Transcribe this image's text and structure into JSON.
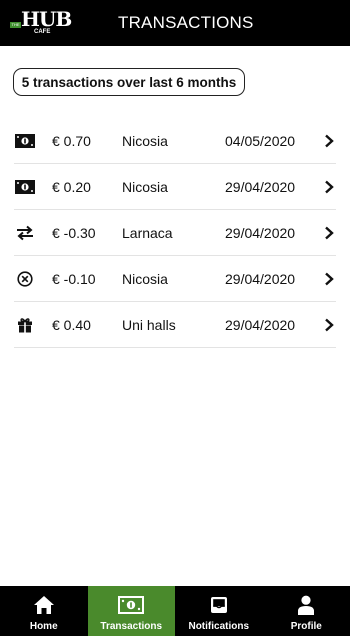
{
  "header": {
    "logo": {
      "text": "HUB",
      "subtext": "CAFE",
      "badge": "THE"
    },
    "title": "TRANSACTIONS"
  },
  "summary": "5 transactions over last 6 months",
  "transactions": [
    {
      "icon": "cash-icon",
      "amount": "€ 0.70",
      "place": "Nicosia",
      "date": "04/05/2020"
    },
    {
      "icon": "cash-icon",
      "amount": "€ 0.20",
      "place": "Nicosia",
      "date": "29/04/2020"
    },
    {
      "icon": "transfer-icon",
      "amount": "€ -0.30",
      "place": "Larnaca",
      "date": "29/04/2020"
    },
    {
      "icon": "cancel-icon",
      "amount": "€ -0.10",
      "place": "Nicosia",
      "date": "29/04/2020"
    },
    {
      "icon": "gift-icon",
      "amount": "€ 0.40",
      "place": "Uni halls",
      "date": "29/04/2020"
    }
  ],
  "nav": [
    {
      "label": "Home",
      "icon": "home-icon"
    },
    {
      "label": "Transactions",
      "icon": "cash-icon",
      "active": true
    },
    {
      "label": "Notifications",
      "icon": "inbox-icon"
    },
    {
      "label": "Profile",
      "icon": "person-icon"
    }
  ],
  "colors": {
    "header_bg": "#000000",
    "accent": "#4a8a2c",
    "logo_green": "#3f8f2e"
  }
}
